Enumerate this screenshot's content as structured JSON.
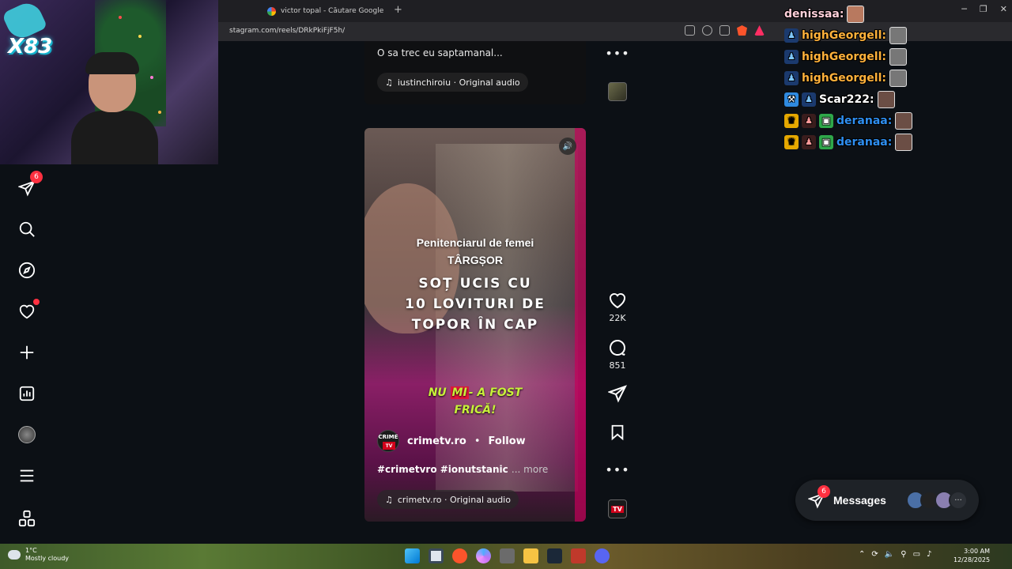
{
  "browser": {
    "tab_title": "victor topal - Căutare Google",
    "new_tab": "+",
    "url": "stagram.com/reels/DRkPkiFjF5h/",
    "win_min": "─",
    "win_max": "❐",
    "win_close": "✕"
  },
  "webcam": {
    "overlay_text": "X83"
  },
  "sidebar": {
    "messages_badge": "6",
    "items": [
      {
        "name": "direct-icon"
      },
      {
        "name": "search-icon"
      },
      {
        "name": "explore-icon"
      },
      {
        "name": "notifications-icon"
      },
      {
        "name": "create-icon"
      },
      {
        "name": "dashboard-icon"
      },
      {
        "name": "profile-icon"
      },
      {
        "name": "menu-icon"
      },
      {
        "name": "more-apps-icon"
      }
    ]
  },
  "reel_top": {
    "caption": "O sa trec eu saptamanal...",
    "audio": "iustinchiroiu · Original audio"
  },
  "reel_main": {
    "overlay_sub_1": "Penitenciarul de femei",
    "overlay_sub_2": "TÂRGȘOR",
    "overlay_big_1": "SOȚ UCIS CU",
    "overlay_big_2": "10 LOVITURI DE",
    "overlay_big_3": "TOPOR ÎN CAP",
    "yellow_1a": "NU ",
    "yellow_1b": "MI",
    "yellow_1c": "- A FOST",
    "yellow_2": "FRICĂ!",
    "author_avatar_top": "CRIME",
    "author_avatar_bottom": "TV",
    "author": "crimetv.ro",
    "separator": "•",
    "follow": "Follow",
    "hashtags": "#crimetvro #ionutstanic",
    "more": "... more",
    "audio": "crimetv.ro · Original audio"
  },
  "rail": {
    "likes": "22K",
    "comments": "851",
    "more_dots": "•••",
    "tv_label": "TV"
  },
  "chat": [
    {
      "user": "denissaa:",
      "color": "#ffd0da"
    },
    {
      "user": "highGeorgell:",
      "color": "#ffb13b"
    },
    {
      "user": "highGeorgell:",
      "color": "#ffb13b"
    },
    {
      "user": "highGeorgell:",
      "color": "#ffb13b"
    },
    {
      "user": "Scar222:",
      "color": "#ffffff"
    },
    {
      "user": "deranaa:",
      "color": "#2e8ef0"
    },
    {
      "user": "deranaa:",
      "color": "#2e8ef0"
    }
  ],
  "messages_pill": {
    "label": "Messages",
    "badge": "6",
    "overflow": "···"
  },
  "taskbar": {
    "temperature": "1°C",
    "condition": "Mostly cloudy",
    "time": "3:00 AM",
    "date": "12/28/2025"
  },
  "colors": {
    "accent_red": "#ff3040",
    "page_bg": "#0c1015"
  }
}
